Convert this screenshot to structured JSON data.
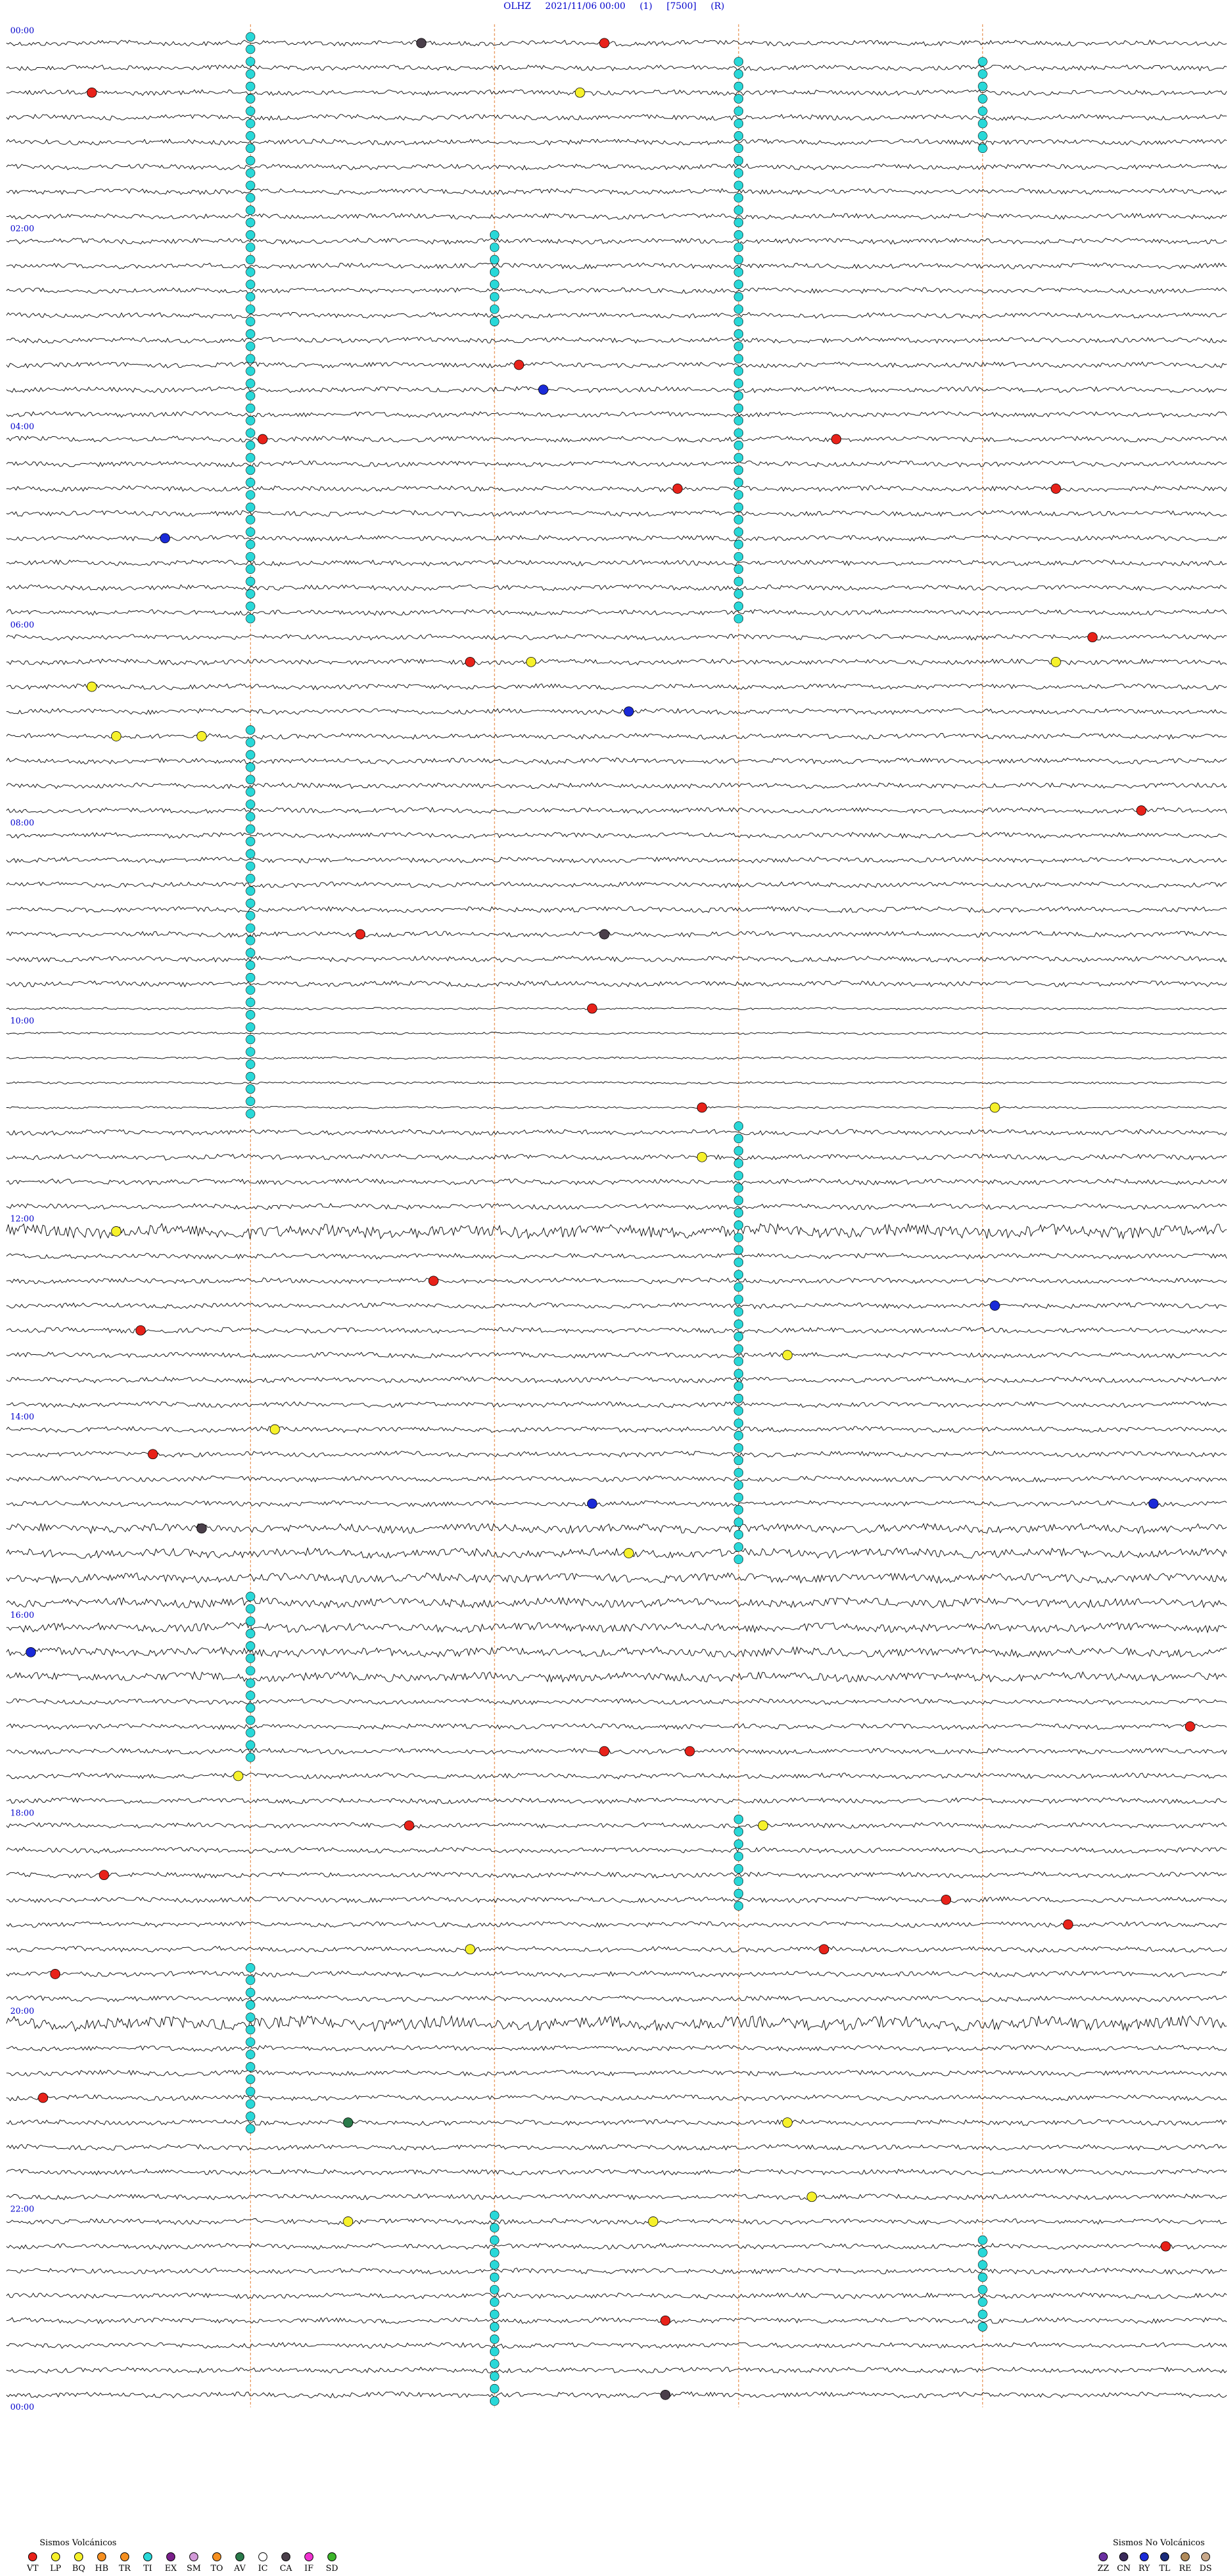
{
  "header": {
    "station": "OLHZ",
    "datetime": "2021/11/06 00:00",
    "channel": "(1)",
    "scale": "[7500]",
    "mode": "(R)"
  },
  "chart_data": {
    "type": "helicorder",
    "row_count": 96,
    "minutes_per_row": 15,
    "hour_labels": [
      "00:00",
      "02:00",
      "04:00",
      "06:00",
      "08:00",
      "10:00",
      "12:00",
      "14:00",
      "16:00",
      "18:00",
      "20:00",
      "22:00",
      "00:00"
    ],
    "trace_color": "#000000",
    "marker_line_color": "#e8965a",
    "hour_label_color": "#0000cc",
    "events": [
      {
        "row": 0,
        "frac": 0.49,
        "type": "VT"
      },
      {
        "row": 0,
        "frac": 0.34,
        "type": "CA"
      },
      {
        "row": 2,
        "frac": 0.07,
        "type": "VT"
      },
      {
        "row": 2,
        "frac": 0.47,
        "type": "BQ"
      },
      {
        "row": 13,
        "frac": 0.42,
        "type": "VT"
      },
      {
        "row": 14,
        "frac": 0.44,
        "type": "RY"
      },
      {
        "row": 16,
        "frac": 0.21,
        "type": "VT"
      },
      {
        "row": 16,
        "frac": 0.68,
        "type": "VT"
      },
      {
        "row": 18,
        "frac": 0.55,
        "type": "VT"
      },
      {
        "row": 18,
        "frac": 0.86,
        "type": "VT"
      },
      {
        "row": 20,
        "frac": 0.13,
        "type": "RY"
      },
      {
        "row": 24,
        "frac": 0.89,
        "type": "VT"
      },
      {
        "row": 25,
        "frac": 0.38,
        "type": "VT"
      },
      {
        "row": 25,
        "frac": 0.43,
        "type": "BQ"
      },
      {
        "row": 25,
        "frac": 0.86,
        "type": "BQ"
      },
      {
        "row": 26,
        "frac": 0.07,
        "type": "BQ"
      },
      {
        "row": 27,
        "frac": 0.51,
        "type": "RY"
      },
      {
        "row": 28,
        "frac": 0.09,
        "type": "BQ"
      },
      {
        "row": 28,
        "frac": 0.16,
        "type": "BQ"
      },
      {
        "row": 31,
        "frac": 0.93,
        "type": "VT"
      },
      {
        "row": 36,
        "frac": 0.29,
        "type": "VT"
      },
      {
        "row": 36,
        "frac": 0.49,
        "type": "CA"
      },
      {
        "row": 39,
        "frac": 0.48,
        "type": "VT"
      },
      {
        "row": 43,
        "frac": 0.57,
        "type": "VT"
      },
      {
        "row": 43,
        "frac": 0.81,
        "type": "BQ"
      },
      {
        "row": 45,
        "frac": 0.57,
        "type": "BQ"
      },
      {
        "row": 48,
        "frac": 0.09,
        "type": "BQ"
      },
      {
        "row": 50,
        "frac": 0.35,
        "type": "VT"
      },
      {
        "row": 51,
        "frac": 0.81,
        "type": "RY"
      },
      {
        "row": 52,
        "frac": 0.11,
        "type": "VT"
      },
      {
        "row": 53,
        "frac": 0.64,
        "type": "BQ"
      },
      {
        "row": 56,
        "frac": 0.22,
        "type": "BQ"
      },
      {
        "row": 57,
        "frac": 0.12,
        "type": "VT"
      },
      {
        "row": 59,
        "frac": 0.94,
        "type": "RY"
      },
      {
        "row": 59,
        "frac": 0.48,
        "type": "RY"
      },
      {
        "row": 60,
        "frac": 0.16,
        "type": "CA"
      },
      {
        "row": 61,
        "frac": 0.51,
        "type": "BQ"
      },
      {
        "row": 65,
        "frac": 0.02,
        "type": "RY"
      },
      {
        "row": 68,
        "frac": 0.97,
        "type": "VT"
      },
      {
        "row": 69,
        "frac": 0.49,
        "type": "VT"
      },
      {
        "row": 69,
        "frac": 0.56,
        "type": "VT"
      },
      {
        "row": 70,
        "frac": 0.19,
        "type": "BQ"
      },
      {
        "row": 72,
        "frac": 0.33,
        "type": "VT"
      },
      {
        "row": 72,
        "frac": 0.62,
        "type": "BQ"
      },
      {
        "row": 74,
        "frac": 0.08,
        "type": "VT"
      },
      {
        "row": 75,
        "frac": 0.77,
        "type": "VT"
      },
      {
        "row": 76,
        "frac": 0.87,
        "type": "VT"
      },
      {
        "row": 77,
        "frac": 0.38,
        "type": "BQ"
      },
      {
        "row": 77,
        "frac": 0.67,
        "type": "VT"
      },
      {
        "row": 78,
        "frac": 0.04,
        "type": "VT"
      },
      {
        "row": 83,
        "frac": 0.03,
        "type": "VT"
      },
      {
        "row": 84,
        "frac": 0.28,
        "type": "AV"
      },
      {
        "row": 84,
        "frac": 0.64,
        "type": "BQ"
      },
      {
        "row": 87,
        "frac": 0.66,
        "type": "BQ"
      },
      {
        "row": 88,
        "frac": 0.28,
        "type": "BQ"
      },
      {
        "row": 88,
        "frac": 0.53,
        "type": "BQ"
      },
      {
        "row": 89,
        "frac": 0.95,
        "type": "VT"
      },
      {
        "row": 92,
        "frac": 0.54,
        "type": "VT"
      },
      {
        "row": 95,
        "frac": 0.54,
        "type": "CA"
      }
    ],
    "ti_columns": [
      {
        "frac": 0.2,
        "from_row": 0,
        "to_row": 24
      },
      {
        "frac": 0.2,
        "from_row": 28,
        "to_row": 44
      },
      {
        "frac": 0.2,
        "from_row": 63,
        "to_row": 70
      },
      {
        "frac": 0.2,
        "from_row": 78,
        "to_row": 85
      },
      {
        "frac": 0.4,
        "from_row": 8,
        "to_row": 12
      },
      {
        "frac": 0.4,
        "from_row": 88,
        "to_row": 96
      },
      {
        "frac": 0.6,
        "from_row": 1,
        "to_row": 24
      },
      {
        "frac": 0.6,
        "from_row": 44,
        "to_row": 62
      },
      {
        "frac": 0.6,
        "from_row": 72,
        "to_row": 76
      },
      {
        "frac": 0.8,
        "from_row": 1,
        "to_row": 5
      },
      {
        "frac": 0.8,
        "from_row": 89,
        "to_row": 93
      }
    ]
  },
  "legend_volcanic": {
    "title": "Sismos Volcánicos",
    "items": [
      {
        "code": "VT",
        "color": "#e8221a"
      },
      {
        "code": "LP",
        "color": "#f6f12b"
      },
      {
        "code": "BQ",
        "color": "#f6f12b"
      },
      {
        "code": "HB",
        "color": "#f58f20"
      },
      {
        "code": "TR",
        "color": "#f58f20"
      },
      {
        "code": "TI",
        "color": "#29d8d8"
      },
      {
        "code": "EX",
        "color": "#7a1f8a"
      },
      {
        "code": "SM",
        "color": "#d29ad8"
      },
      {
        "code": "TO",
        "color": "#f58f20"
      },
      {
        "code": "AV",
        "color": "#2a7a4a"
      },
      {
        "code": "IC",
        "color": "#ffffff"
      },
      {
        "code": "CA",
        "color": "#4a3f4a"
      },
      {
        "code": "IF",
        "color": "#f032d0"
      },
      {
        "code": "SD",
        "color": "#3cb42a"
      }
    ]
  },
  "legend_nonvolcanic": {
    "title": "Sismos No Volcánicos",
    "items": [
      {
        "code": "ZZ",
        "color": "#6a2fa0"
      },
      {
        "code": "CN",
        "color": "#3a2a5a"
      },
      {
        "code": "RY",
        "color": "#1a2ad8"
      },
      {
        "code": "TL",
        "color": "#1a2a7a"
      },
      {
        "code": "RE",
        "color": "#b08a5a"
      },
      {
        "code": "DS",
        "color": "#c8a88a"
      }
    ]
  }
}
